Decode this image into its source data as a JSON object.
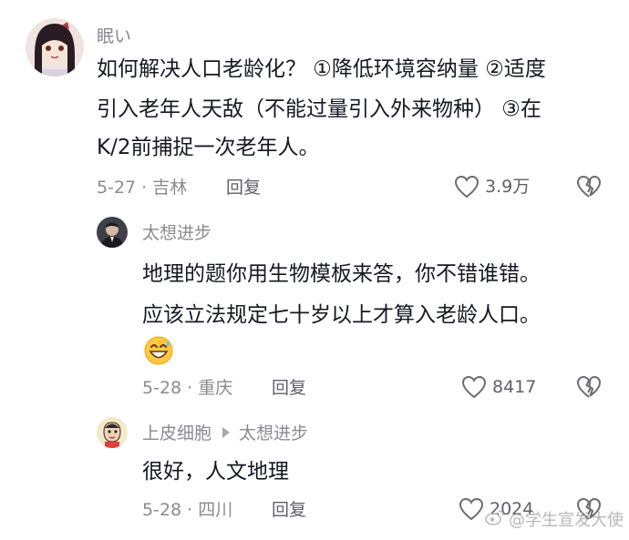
{
  "comments": [
    {
      "username": "眠い",
      "lines": [
        "如何解决人口老龄化？ ①降低环境容纳量 ②适度",
        "引入老年人天敌（不能过量引入外来物种） ③在",
        "K/2前捕捉一次老年人。"
      ],
      "meta": "5-27 · 吉林",
      "reply_label": "回复",
      "likes": "3.9万"
    },
    {
      "username": "太想进步",
      "lines": [
        "地理的题你用生物模板来答，你不错谁错。",
        "应该立法规定七十岁以上才算入老龄人口。"
      ],
      "emoji": "grinning-sweat-emoji",
      "meta": "5-28 · 重庆",
      "reply_label": "回复",
      "likes": "8417"
    },
    {
      "username": "上皮细胞",
      "reply_to": "太想进步",
      "lines": [
        "很好，人文地理"
      ],
      "meta": "5-28 · 四川",
      "reply_label": "回复",
      "likes": "2024"
    }
  ],
  "watermark": "@学生宣发大使"
}
